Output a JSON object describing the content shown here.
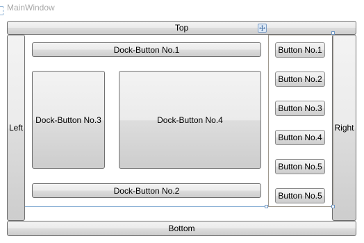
{
  "window": {
    "title": "MainWindow"
  },
  "dock_edges": {
    "top": "Top",
    "bottom": "Bottom",
    "left": "Left",
    "right": "Right"
  },
  "inner_dock": {
    "top": "Dock-Button No.1",
    "bottom": "Dock-Button No.2",
    "left": "Dock-Button No.3",
    "fill": "Dock-Button No.4"
  },
  "stack_panel": {
    "buttons": [
      "Button No.1",
      "Button No.2",
      "Button No.3",
      "Button No.4",
      "Button No.5",
      "Button No.5"
    ]
  },
  "icons": {
    "move_handle": "move-arrows-icon"
  },
  "colors": {
    "button_border": "#707070",
    "selection_border": "#a09a90",
    "adorner_blue": "#6f97c4",
    "title_text": "#a8a8a8"
  }
}
